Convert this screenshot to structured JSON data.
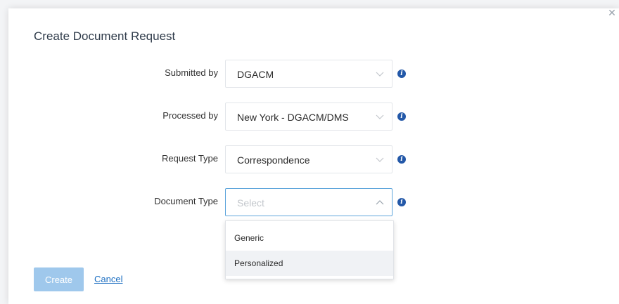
{
  "modal": {
    "title": "Create Document Request",
    "close_icon": "close-icon"
  },
  "fields": {
    "submitted_by": {
      "label": "Submitted by",
      "value": "DGACM"
    },
    "processed_by": {
      "label": "Processed by",
      "value": "New York - DGACM/DMS"
    },
    "request_type": {
      "label": "Request Type",
      "value": "Correspondence"
    },
    "document_type": {
      "label": "Document Type",
      "placeholder": "Select"
    }
  },
  "document_type_options": [
    "Generic",
    "Personalized"
  ],
  "buttons": {
    "create_label": "Create",
    "cancel_label": "Cancel"
  },
  "icons": {
    "info": "info-icon",
    "chevron_down": "chevron-down-icon",
    "chevron_up": "chevron-up-icon"
  },
  "colors": {
    "accent": "#5fa6dc",
    "info_icon": "#2358a8",
    "create_button_disabled": "#9fc8ec",
    "link": "#1d6fc2"
  }
}
